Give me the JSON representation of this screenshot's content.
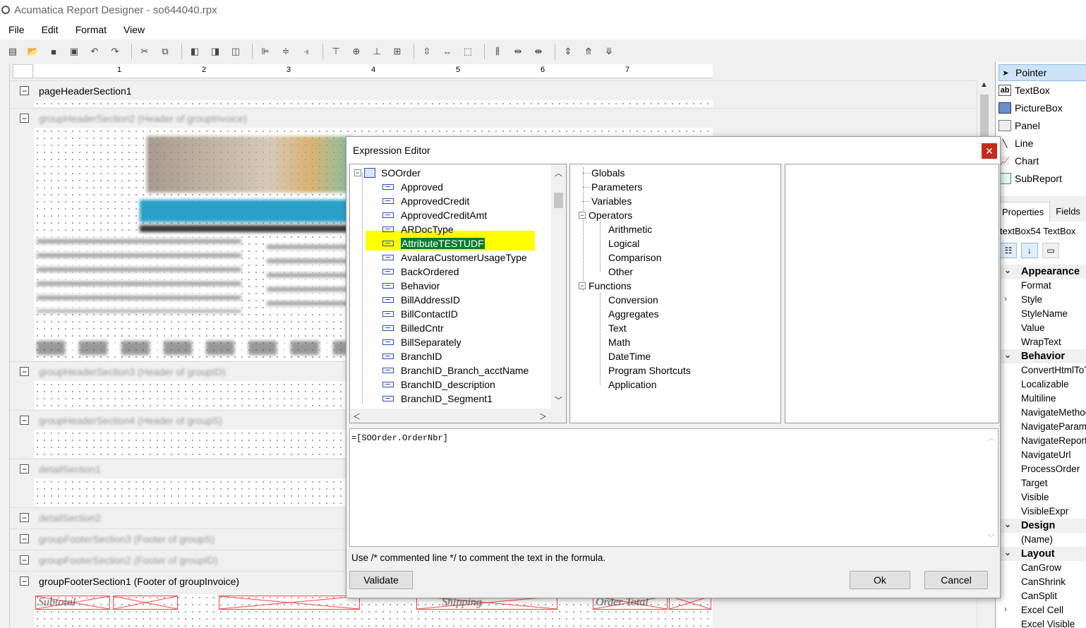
{
  "window": {
    "title": "Acumatica Report Designer - so644040.rpx"
  },
  "menu": [
    "File",
    "Edit",
    "Format",
    "View"
  ],
  "toolbar_icons": [
    "new-icon",
    "open-icon",
    "save-icon",
    "save-as-icon",
    "undo-icon",
    "redo-icon",
    "cut-icon",
    "copy-icon",
    "bring-front-icon",
    "send-back-icon",
    "group-icon",
    "align-left-icon",
    "align-center-icon",
    "align-right-icon",
    "align-top-icon",
    "align-middle-icon",
    "align-bottom-icon",
    "size-both-icon",
    "same-height-icon",
    "same-width-icon",
    "same-size-icon",
    "hspace-equal-icon",
    "hspace-increase-icon",
    "hspace-decrease-icon",
    "vspace-equal-icon",
    "vspace-increase-icon",
    "vspace-decrease-icon"
  ],
  "ruler": [
    "1",
    "2",
    "3",
    "4",
    "5",
    "6",
    "7"
  ],
  "sections": {
    "pageHeader": "pageHeaderSection1",
    "groupHeader2": "groupHeaderSection2 (Header of groupInvoice)",
    "groupHeader3": "groupHeaderSection3 (Header of groupID)",
    "groupHeader4": "groupHeaderSection4 (Header of groupS)",
    "detail1": "detailSection1",
    "detail2": "detailSection2",
    "groupFooter3": "groupFooterSection3 (Footer of groupS)",
    "groupFooter2": "groupFooterSection2 (Footer of groupID)",
    "groupFooter1": "groupFooterSection1 (Footer of groupInvoice)"
  },
  "footer_labels": {
    "subtotal": "Subtotal",
    "shipping": "Shipping",
    "order_total": "Order Total"
  },
  "toolbox": {
    "items": [
      {
        "label": "Pointer",
        "icon": "pointer-icon"
      },
      {
        "label": "TextBox",
        "icon": "textbox-icon"
      },
      {
        "label": "PictureBox",
        "icon": "picturebox-icon"
      },
      {
        "label": "Panel",
        "icon": "panel-icon"
      },
      {
        "label": "Line",
        "icon": "line-icon"
      },
      {
        "label": "Chart",
        "icon": "chart-icon"
      },
      {
        "label": "SubReport",
        "icon": "subreport-icon"
      }
    ]
  },
  "properties": {
    "tabs": [
      "Properties",
      "Fields"
    ],
    "object": "textBox54 TextBox",
    "rows": [
      {
        "label": "Appearance",
        "cat": true
      },
      {
        "label": "Format"
      },
      {
        "label": "Style",
        "exp": ">"
      },
      {
        "label": "StyleName"
      },
      {
        "label": "Value"
      },
      {
        "label": "WrapText"
      },
      {
        "label": "Behavior",
        "cat": true
      },
      {
        "label": "ConvertHtmlToText"
      },
      {
        "label": "Localizable"
      },
      {
        "label": "Multiline"
      },
      {
        "label": "NavigateMethod"
      },
      {
        "label": "NavigateParams"
      },
      {
        "label": "NavigateReport"
      },
      {
        "label": "NavigateUrl"
      },
      {
        "label": "ProcessOrder"
      },
      {
        "label": "Target"
      },
      {
        "label": "Visible"
      },
      {
        "label": "VisibleExpr"
      },
      {
        "label": "Design",
        "cat": true
      },
      {
        "label": "(Name)"
      },
      {
        "label": "Layout",
        "cat": true
      },
      {
        "label": "CanGrow"
      },
      {
        "label": "CanShrink"
      },
      {
        "label": "CanSplit"
      },
      {
        "label": "Excel Cell",
        "exp": ">"
      },
      {
        "label": "Excel Visible"
      }
    ]
  },
  "dialog": {
    "title": "Expression Editor",
    "root": "SOOrder",
    "fields": [
      "Approved",
      "ApprovedCredit",
      "ApprovedCreditAmt",
      "ARDocType",
      "AttributeTESTUDF",
      "AvalaraCustomerUsageType",
      "BackOrdered",
      "Behavior",
      "BillAddressID",
      "BillContactID",
      "BilledCntr",
      "BillSeparately",
      "BranchID",
      "BranchID_Branch_acctName",
      "BranchID_description",
      "BranchID_Segment1"
    ],
    "selected_field": "AttributeTESTUDF",
    "functions_tree": {
      "globals": "Globals",
      "parameters": "Parameters",
      "variables": "Variables",
      "operators": "Operators",
      "operator_items": [
        "Arithmetic",
        "Logical",
        "Comparison",
        "Other"
      ],
      "functions": "Functions",
      "function_items": [
        "Conversion",
        "Aggregates",
        "Text",
        "Math",
        "DateTime",
        "Program Shortcuts",
        "Application"
      ]
    },
    "expression": "=[SOOrder.OrderNbr]",
    "hint": "Use /* commented line */ to comment the text in the formula.",
    "validate": "Validate",
    "ok": "Ok",
    "cancel": "Cancel"
  }
}
